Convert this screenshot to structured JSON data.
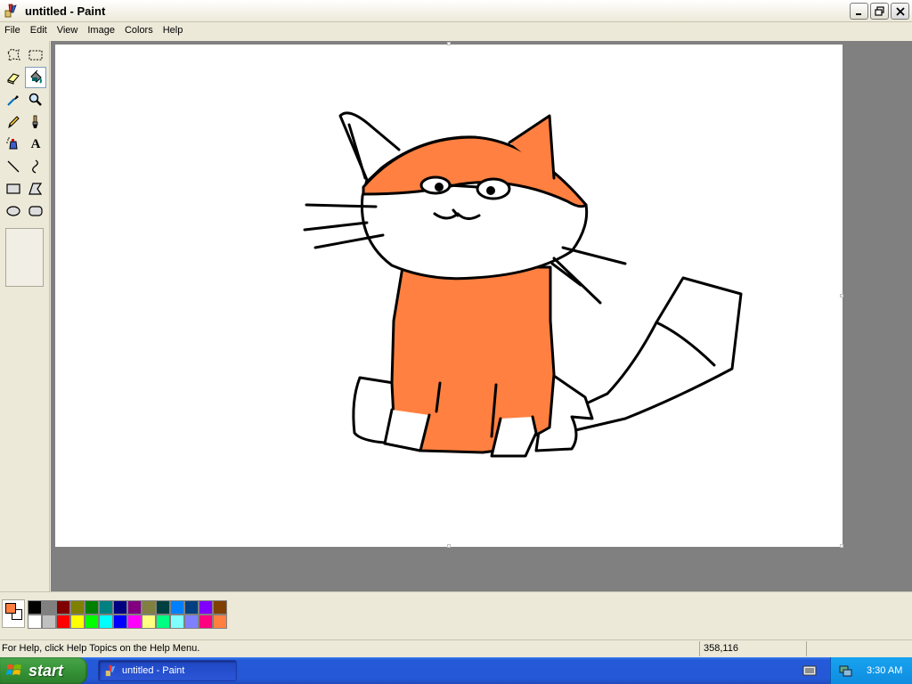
{
  "window": {
    "title": "untitled - Paint"
  },
  "menu": [
    "File",
    "Edit",
    "View",
    "Image",
    "Colors",
    "Help"
  ],
  "tools": [
    {
      "name": "free-form-select-icon"
    },
    {
      "name": "select-icon"
    },
    {
      "name": "eraser-icon"
    },
    {
      "name": "fill-bucket-icon",
      "active": true
    },
    {
      "name": "pick-color-icon"
    },
    {
      "name": "magnifier-icon"
    },
    {
      "name": "pencil-icon"
    },
    {
      "name": "brush-icon"
    },
    {
      "name": "airbrush-icon"
    },
    {
      "name": "text-icon"
    },
    {
      "name": "line-icon"
    },
    {
      "name": "curve-icon"
    },
    {
      "name": "rectangle-icon"
    },
    {
      "name": "polygon-icon"
    },
    {
      "name": "ellipse-icon"
    },
    {
      "name": "rounded-rectangle-icon"
    }
  ],
  "text_tool_glyph": "A",
  "colors": {
    "foreground": "#ff7f40",
    "background": "#ffffff",
    "cat_orange": "#ff8040",
    "palette_top": [
      "#000000",
      "#808080",
      "#800000",
      "#808000",
      "#008000",
      "#008080",
      "#000080",
      "#800080",
      "#808040",
      "#004040",
      "#0080ff",
      "#004080",
      "#8000ff",
      "#804000"
    ],
    "palette_bottom": [
      "#ffffff",
      "#c0c0c0",
      "#ff0000",
      "#ffff00",
      "#00ff00",
      "#00ffff",
      "#0000ff",
      "#ff00ff",
      "#ffff80",
      "#00ff80",
      "#80ffff",
      "#8080ff",
      "#ff0080",
      "#ff8040"
    ]
  },
  "status": {
    "help_text": "For Help, click Help Topics on the Help Menu.",
    "coords": "358,116"
  },
  "taskbar": {
    "start_label": "start",
    "task_label": "untitled - Paint",
    "clock": "3:30 AM"
  }
}
